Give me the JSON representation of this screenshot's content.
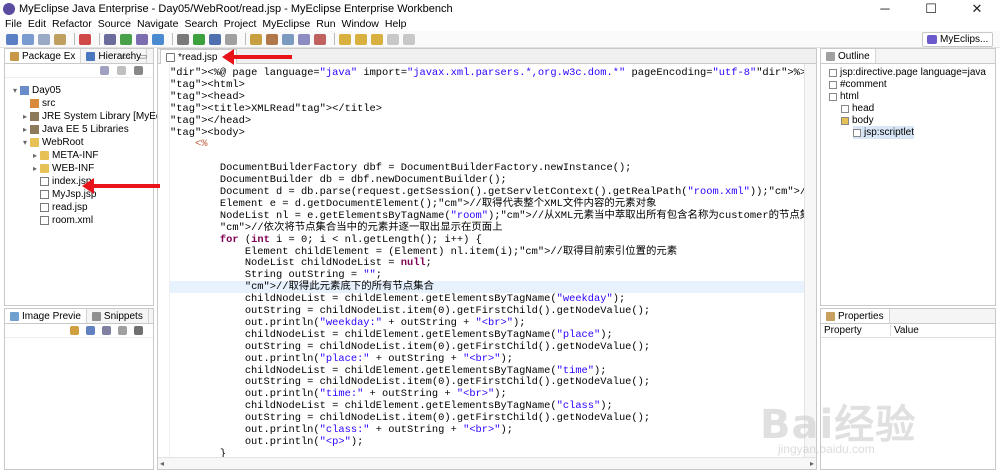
{
  "window": {
    "title": "MyEclipse Java Enterprise - Day05/WebRoot/read.jsp - MyEclipse Enterprise Workbench",
    "minimize": "─",
    "maximize": "☐",
    "close": "✕"
  },
  "menubar": [
    "File",
    "Edit",
    "Refactor",
    "Source",
    "Navigate",
    "Search",
    "Project",
    "MyEclipse",
    "Run",
    "Window",
    "Help"
  ],
  "perspective": "MyEclips...",
  "left_panel": {
    "tabs": [
      "Package Ex",
      "Hierarchy"
    ],
    "tree": [
      {
        "label": "Day05",
        "indent": 0,
        "twisty": "▾",
        "icon": "project"
      },
      {
        "label": "src",
        "indent": 1,
        "twisty": "",
        "icon": "package-root"
      },
      {
        "label": "JRE System Library [MyEclipse]",
        "indent": 1,
        "twisty": "▸",
        "icon": "library"
      },
      {
        "label": "Java EE 5 Libraries",
        "indent": 1,
        "twisty": "▸",
        "icon": "library"
      },
      {
        "label": "WebRoot",
        "indent": 1,
        "twisty": "▾",
        "icon": "folder"
      },
      {
        "label": "META-INF",
        "indent": 2,
        "twisty": "▸",
        "icon": "folder"
      },
      {
        "label": "WEB-INF",
        "indent": 2,
        "twisty": "▸",
        "icon": "folder"
      },
      {
        "label": "index.jsp",
        "indent": 2,
        "twisty": "",
        "icon": "jsp-file"
      },
      {
        "label": "MyJsp.jsp",
        "indent": 2,
        "twisty": "",
        "icon": "jsp-file"
      },
      {
        "label": "read.jsp",
        "indent": 2,
        "twisty": "",
        "icon": "jsp-file"
      },
      {
        "label": "room.xml",
        "indent": 2,
        "twisty": "",
        "icon": "xml-file"
      }
    ]
  },
  "bottom_left_panel": {
    "tabs": [
      "Image Previe",
      "Snippets"
    ]
  },
  "editor": {
    "tab_label": "*read.jsp",
    "tab_close": "✕",
    "lines": [
      "<%@ page language=\"java\" import=\"javax.xml.parsers.*,org.w3c.dom.*\" pageEncoding=\"utf-8\"%><!-- 载入XM",
      "<html>",
      "<head>",
      "<title>XMLRead</title>",
      "</head>",
      "<body>",
      "    <%",
      "",
      "        DocumentBuilderFactory dbf = DocumentBuilderFactory.newInstance();",
      "        DocumentBuilder db = dbf.newDocumentBuilder();",
      "        Document d = db.parse(request.getSession().getServletContext().getRealPath(\"room.xml\"));//建",
      "        Element e = d.getDocumentElement();//取得代表整个XML文件内容的元素对象",
      "        NodeList nl = e.getElementsByTagName(\"room\");//从XML元素当中萃取出所有包含名称为customer的节点集合对",
      "        //依次将节点集合当中的元素并逐一取出显示在页面上",
      "        for (int i = 0; i < nl.getLength(); i++) {",
      "            Element childElement = (Element) nl.item(i);//取得目前索引位置的元素",
      "            NodeList childNodeList = null;",
      "            String outString = \"\";",
      "            //取得此元素底下的所有节点集合",
      "            childNodeList = childElement.getElementsByTagName(\"weekday\");",
      "            outString = childNodeList.item(0).getFirstChild().getNodeValue();",
      "            out.println(\"weekday:\" + outString + \"<br>\");",
      "            childNodeList = childElement.getElementsByTagName(\"place\");",
      "            outString = childNodeList.item(0).getFirstChild().getNodeValue();",
      "            out.println(\"place:\" + outString + \"<br>\");",
      "            childNodeList = childElement.getElementsByTagName(\"time\");",
      "            outString = childNodeList.item(0).getFirstChild().getNodeValue();",
      "            out.println(\"time:\" + outString + \"<br>\");",
      "            childNodeList = childElement.getElementsByTagName(\"class\");",
      "            outString = childNodeList.item(0).getFirstChild().getNodeValue();",
      "            out.println(\"class:\" + outString + \"<br>\");",
      "            out.println(\"<p>\");",
      "        }",
      "    %>"
    ]
  },
  "outline": {
    "tab": "Outline",
    "items": [
      {
        "label": "jsp:directive.page language=java",
        "indent": 0
      },
      {
        "label": "#comment",
        "indent": 0
      },
      {
        "label": "html",
        "indent": 0
      },
      {
        "label": "head",
        "indent": 1
      },
      {
        "label": "body",
        "indent": 1
      },
      {
        "label": "jsp:scriptlet",
        "indent": 2
      }
    ]
  },
  "properties": {
    "tab": "Properties",
    "col_property": "Property",
    "col_value": "Value"
  },
  "watermark": {
    "text": "Bai经验",
    "sub": "jingyan.baidu.com"
  },
  "colors": {
    "arrow": "#e8141a",
    "keyword": "#7f0055",
    "string": "#2a00ff",
    "comment": "#3f7f5f"
  }
}
